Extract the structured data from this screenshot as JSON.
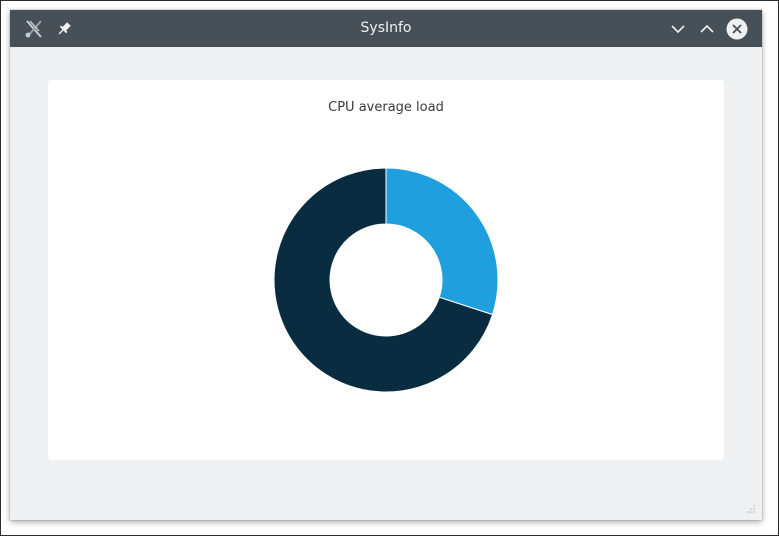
{
  "window": {
    "title": "SysInfo",
    "titlebar_color": "#475057",
    "background_color": "#eff0f1"
  },
  "icons": {
    "app": "app-icon",
    "pin": "pin-icon",
    "minimize": "chevron-down-icon",
    "maximize": "chevron-up-icon",
    "close": "close-icon"
  },
  "chart_data": {
    "type": "pie",
    "title": "CPU average load",
    "donut": true,
    "slices": [
      {
        "value": 30,
        "color": "#209fdf"
      },
      {
        "value": 70,
        "color": "#092c40"
      }
    ]
  }
}
